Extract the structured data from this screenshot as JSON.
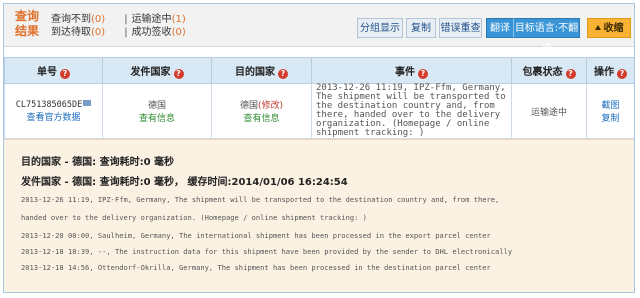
{
  "summary": {
    "title": "查询结果",
    "stats": [
      {
        "label": "查询不到",
        "count": "(0)"
      },
      {
        "label": "运输途中",
        "count": "(1)"
      },
      {
        "label": "到达待取",
        "count": "(0)"
      },
      {
        "label": "成功签收",
        "count": "(0)"
      }
    ],
    "separator": "|",
    "buttons": {
      "group_display": "分组显示",
      "copy": "复制",
      "error_recheck": "错误重查",
      "translate": "翻译",
      "target_language": "目标语言:不翻译",
      "collapse": "收缩"
    }
  },
  "table": {
    "headers": [
      "单号",
      "发件国家",
      "目的国家",
      "事件",
      "包裹状态",
      "操作"
    ],
    "row": {
      "tracking_no": "CL751385065DE",
      "official_link": "查看官方数据",
      "origin_country": "德国",
      "origin_link": "查有信息",
      "dest_country": "德国",
      "dest_modify": "(修改)",
      "dest_link": "查有信息",
      "event": "2013-12-26 11:19, IPZ-Ffm, Germany, The shipment will be transported to the destination country and, from there, handed over to the delivery organization. (Homepage / online shipment tracking: )",
      "status": "运输途中",
      "actions": [
        "截图",
        "复制"
      ]
    }
  },
  "details": {
    "dest_line": "目的国家 - 德国: 查询耗时:0 毫秒",
    "origin_line": "发件国家 - 德国: 查询耗时:0 毫秒， 缓存时间:2014/01/06 16:24:54",
    "log": [
      "2013-12-26 11:19, IPZ-Ffm, Germany, The shipment will be transported to the destination country and, from there,",
      "handed over to the delivery organization. (Homepage / online shipment tracking: )",
      "2013-12-20 00:00, Saulheim, Germany, The international shipment has been processed in the export parcel center",
      "2013-12-18 18:39, --, The instruction data for this shipment have been provided by the sender to DHL electronically",
      "2013-12-18 14:56, Ottendorf-Okrilla, Germany, The shipment has been processed in the destination parcel center"
    ]
  },
  "colors": {
    "accent_orange": "#e0702a",
    "header_blue": "#d9e8f5",
    "details_bg": "#fcf2e4",
    "link_blue": "#1a6dbf",
    "info_green": "#2e8b2e"
  },
  "icons": {
    "help": "question-icon",
    "screenshot": "screenshot-icon"
  }
}
